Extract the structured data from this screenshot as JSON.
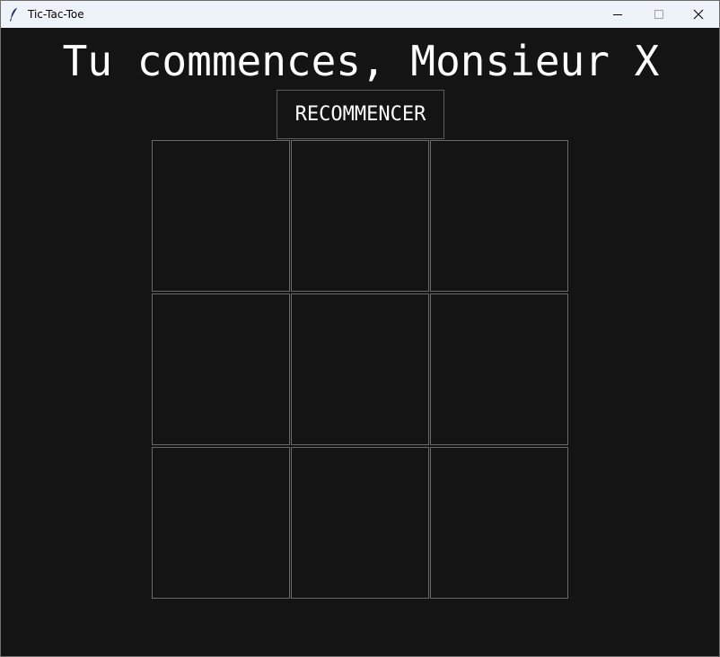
{
  "window": {
    "title": "Tic-Tac-Toe",
    "app_icon": "feather-icon",
    "controls": [
      "minimize-icon",
      "maximize-icon",
      "close-icon"
    ]
  },
  "game": {
    "status": "Tu commences, Monsieur X",
    "restart_label": "RECOMMENCER",
    "board": [
      "",
      "",
      "",
      "",
      "",
      "",
      "",
      "",
      ""
    ]
  },
  "colors": {
    "background": "#141414",
    "text": "#ffffff",
    "cell_border": "#6a6a6a",
    "titlebar": "#eef3fa"
  }
}
